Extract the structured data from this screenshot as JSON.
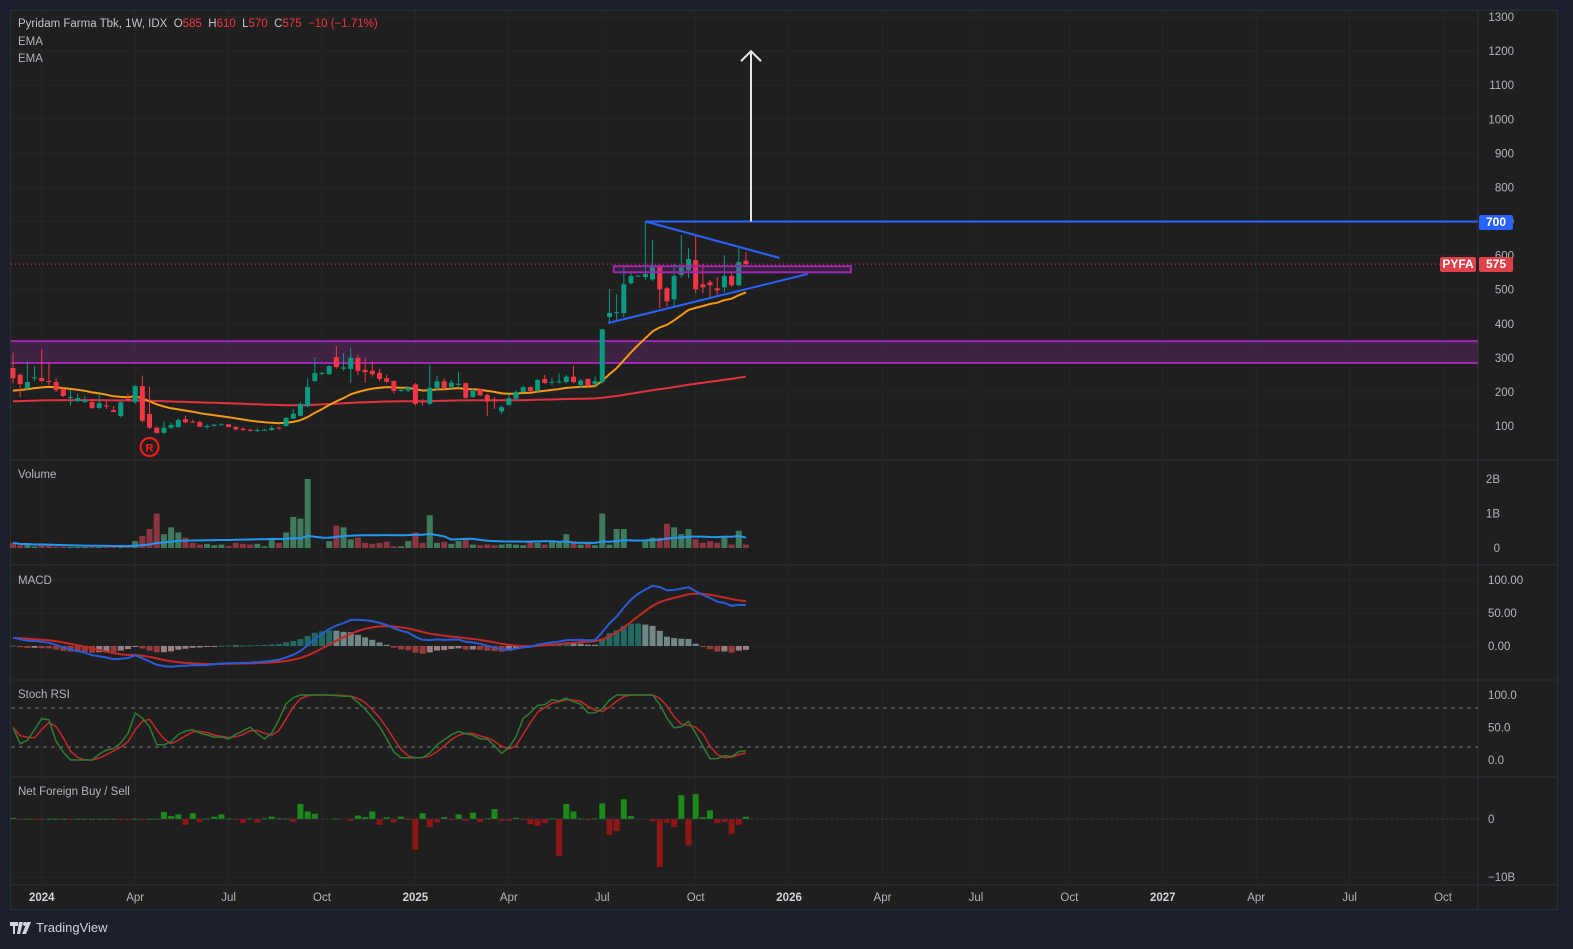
{
  "header": {
    "symbol_line": "Pyridam Farma Tbk, 1W, IDX",
    "o_label": "O",
    "o": "585",
    "h_label": "H",
    "h": "610",
    "l_label": "L",
    "l": "570",
    "c_label": "C",
    "c": "575",
    "change": "−10 (−1.71%)",
    "indicators": [
      "EMA",
      "EMA"
    ]
  },
  "panes": {
    "volume": "Volume",
    "macd": "MACD",
    "stoch": "Stoch RSI",
    "net_foreign": "Net Foreign Buy / Sell"
  },
  "badges": {
    "level": "700",
    "symbol": "PYFA",
    "last": "575"
  },
  "footer": {
    "brand": "TradingView"
  },
  "colors": {
    "up": "#089981",
    "down": "#f23645",
    "ema_fast": "#f59a12",
    "ema_slow": "#e0323f",
    "trendline": "#2962ff",
    "zone": "#9c27b0",
    "volume_up": "#3f7a5c",
    "volume_down": "#8a3540",
    "volume_ma": "#2196f3",
    "macd": "#2a5bd7",
    "signal": "#c62828",
    "stoch_k": "#2e7d32",
    "stoch_d": "#c62828",
    "nf_buy": "#1b8a1b",
    "nf_sell": "#8e1616"
  },
  "chart_data": {
    "type": "candlestick",
    "title": "Pyridam Farma Tbk, 1W, IDX",
    "candles": [
      [
        270,
        315,
        225,
        240
      ],
      [
        250,
        255,
        185,
        223
      ],
      [
        211,
        290,
        205,
        229
      ],
      [
        240,
        276,
        232,
        243
      ],
      [
        241,
        326,
        228,
        232
      ],
      [
        232,
        285,
        220,
        229
      ],
      [
        229,
        240,
        200,
        205
      ],
      [
        208,
        215,
        185,
        188
      ],
      [
        182,
        206,
        160,
        185
      ],
      [
        173,
        195,
        170,
        182
      ],
      [
        170,
        188,
        168,
        176
      ],
      [
        170,
        180,
        150,
        153
      ],
      [
        153,
        195,
        150,
        167
      ],
      [
        160,
        175,
        150,
        157
      ],
      [
        147,
        158,
        140,
        141
      ],
      [
        129,
        172,
        125,
        170
      ],
      [
        180,
        195,
        172,
        176
      ],
      [
        170,
        220,
        165,
        217
      ],
      [
        217,
        248,
        110,
        115
      ],
      [
        135,
        215,
        90,
        95
      ],
      [
        95,
        98,
        78,
        80
      ],
      [
        80,
        115,
        76,
        95
      ],
      [
        95,
        110,
        92,
        103
      ],
      [
        97,
        122,
        95,
        118
      ],
      [
        120,
        130,
        108,
        111
      ],
      [
        113,
        118,
        110,
        112
      ],
      [
        112,
        115,
        97,
        98
      ],
      [
        98,
        105,
        90,
        100
      ],
      [
        101,
        106,
        98,
        104
      ],
      [
        104,
        108,
        102,
        105
      ],
      [
        105,
        106,
        96,
        97
      ],
      [
        97,
        100,
        88,
        90
      ],
      [
        92,
        96,
        86,
        88
      ],
      [
        89,
        92,
        84,
        86
      ],
      [
        86,
        94,
        82,
        88
      ],
      [
        88,
        92,
        86,
        89
      ],
      [
        88,
        100,
        86,
        94
      ],
      [
        95,
        98,
        90,
        94
      ],
      [
        100,
        126,
        98,
        124
      ],
      [
        122,
        150,
        120,
        136
      ],
      [
        130,
        170,
        128,
        165
      ],
      [
        158,
        240,
        155,
        214
      ],
      [
        232,
        302,
        228,
        255
      ],
      [
        254,
        258,
        250,
        256
      ],
      [
        252,
        278,
        250,
        276
      ],
      [
        302,
        335,
        268,
        273
      ],
      [
        268,
        314,
        262,
        272
      ],
      [
        267,
        330,
        226,
        300
      ],
      [
        300,
        310,
        250,
        262
      ],
      [
        265,
        300,
        226,
        258
      ],
      [
        262,
        290,
        245,
        252
      ],
      [
        256,
        268,
        232,
        238
      ],
      [
        240,
        250,
        226,
        230
      ],
      [
        232,
        234,
        195,
        203
      ],
      [
        203,
        212,
        200,
        206
      ],
      [
        204,
        215,
        200,
        213
      ],
      [
        222,
        226,
        160,
        165
      ],
      [
        172,
        180,
        160,
        170
      ],
      [
        165,
        280,
        162,
        212
      ],
      [
        212,
        248,
        205,
        231
      ],
      [
        231,
        240,
        205,
        212
      ],
      [
        215,
        235,
        210,
        227
      ],
      [
        224,
        260,
        210,
        224
      ],
      [
        226,
        228,
        180,
        183
      ],
      [
        185,
        210,
        183,
        203
      ],
      [
        208,
        210,
        188,
        190
      ],
      [
        191,
        195,
        130,
        172
      ],
      [
        176,
        185,
        150,
        172
      ],
      [
        143,
        160,
        135,
        155
      ],
      [
        162,
        190,
        160,
        182
      ],
      [
        180,
        205,
        175,
        200
      ],
      [
        200,
        218,
        198,
        214
      ],
      [
        214,
        216,
        200,
        203
      ],
      [
        203,
        238,
        200,
        235
      ],
      [
        238,
        250,
        224,
        226
      ],
      [
        230,
        240,
        220,
        230
      ],
      [
        228,
        255,
        225,
        231
      ],
      [
        229,
        250,
        225,
        245
      ],
      [
        245,
        276,
        225,
        229
      ],
      [
        220,
        238,
        212,
        233
      ],
      [
        238,
        240,
        215,
        219
      ],
      [
        222,
        245,
        218,
        232
      ],
      [
        229,
        384,
        225,
        384
      ],
      [
        420,
        502,
        402,
        432
      ],
      [
        432,
        487,
        405,
        434
      ],
      [
        431,
        566,
        420,
        516
      ],
      [
        519,
        552,
        515,
        540
      ],
      [
        540,
        542,
        538,
        541
      ],
      [
        537,
        700,
        528,
        546
      ],
      [
        530,
        645,
        525,
        566
      ],
      [
        566,
        570,
        446,
        501
      ],
      [
        504,
        508,
        450,
        466
      ],
      [
        472,
        575,
        446,
        540
      ],
      [
        543,
        660,
        535,
        566
      ],
      [
        557,
        622,
        534,
        590
      ],
      [
        587,
        660,
        490,
        501
      ],
      [
        516,
        575,
        490,
        507
      ],
      [
        522,
        528,
        478,
        513
      ],
      [
        504,
        537,
        478,
        498
      ],
      [
        507,
        601,
        492,
        540
      ],
      [
        540,
        548,
        508,
        513
      ],
      [
        513,
        622,
        510,
        581
      ],
      [
        585,
        610,
        570,
        575
      ]
    ],
    "volume_billions": [
      0.15,
      0.08,
      0.12,
      0.05,
      0.12,
      0.07,
      0.04,
      0.04,
      0.03,
      0.03,
      0.03,
      0.03,
      0.03,
      0.03,
      0.03,
      0.03,
      0.05,
      0.2,
      0.35,
      0.55,
      1.0,
      0.4,
      0.6,
      0.45,
      0.3,
      0.15,
      0.1,
      0.12,
      0.08,
      0.1,
      0.06,
      0.15,
      0.12,
      0.1,
      0.12,
      0.05,
      0.25,
      0.15,
      0.45,
      0.9,
      0.85,
      2.0,
      0,
      0,
      0.2,
      0.65,
      0.6,
      0.25,
      0.3,
      0.15,
      0.12,
      0.15,
      0.18,
      0.05,
      0.05,
      0.2,
      0.45,
      0.15,
      0.95,
      0.15,
      0.18,
      0.12,
      0.2,
      0.25,
      0.1,
      0.08,
      0.1,
      0.08,
      0.1,
      0.12,
      0.1,
      0.08,
      0.2,
      0.15,
      0.1,
      0.2,
      0.15,
      0.4,
      0.2,
      0.1,
      0.15,
      0.08,
      1.0,
      0.1,
      0.55,
      0.55,
      0,
      0,
      0.2,
      0.3,
      0.3,
      0.7,
      0.6,
      0.4,
      0.55,
      0.25,
      0.15,
      0.2,
      0.15,
      0.35,
      0.1,
      0.5,
      0.1
    ],
    "net_foreign_billions": [
      0.2,
      -0.1,
      0.05,
      -0.1,
      -0.1,
      0.05,
      0.05,
      0.05,
      -0.1,
      0.05,
      0.05,
      0.05,
      0.05,
      0.05,
      0.05,
      -0.1,
      -0.2,
      0.05,
      -0.2,
      0.05,
      0.05,
      1.2,
      0.5,
      0.8,
      -1.0,
      1.0,
      -0.5,
      0.1,
      0.4,
      0.8,
      0.1,
      -0.1,
      -0.7,
      0.1,
      -0.6,
      0.1,
      0.4,
      0.1,
      0.1,
      -0.5,
      2.6,
      1.3,
      0.9,
      0,
      0,
      0.1,
      0,
      -0.3,
      0.6,
      0.3,
      1.3,
      -1.0,
      0.3,
      -0.6,
      0.4,
      -0.1,
      -5.3,
      1.0,
      -1.4,
      -0.6,
      0.3,
      -0.1,
      0.8,
      -0.3,
      1.1,
      -0.5,
      0.1,
      1.7,
      -0.3,
      -0.3,
      0.2,
      -0.1,
      -0.9,
      -1.2,
      -0.7,
      0.1,
      -6.4,
      2.6,
      1.3,
      0.1,
      -0.2,
      0.1,
      2.7,
      -2.7,
      -2.1,
      3.4,
      0.5,
      0,
      0,
      -0.4,
      -8.3,
      -0.7,
      -1.4,
      4.1,
      -4.6,
      4.3,
      0.3,
      1.5,
      -0.7,
      -0.5,
      -2.6,
      -1.0,
      0.4
    ],
    "ema_fast": {
      "period": 20,
      "seed": 200
    },
    "ema_slow": {
      "period": 200,
      "seed": 172
    },
    "volume_ma_period": 20,
    "macd_params": {
      "fast": 12,
      "slow": 26,
      "signal": 9,
      "seed_fast": 250,
      "seed_slow": 235,
      "seed_signal": 12
    },
    "stoch_rsi_params": {
      "rsi": 14,
      "stoch": 14,
      "k": 3,
      "d": 3,
      "upper_band": 80,
      "lower_band": 20
    },
    "price_axis": {
      "ticks": [
        100,
        200,
        300,
        400,
        500,
        600,
        700,
        800,
        900,
        1000,
        1100,
        1200,
        1300
      ],
      "range": [
        0,
        1300
      ]
    },
    "volume_axis": {
      "ticks": [
        {
          "v": 0,
          "label": "0"
        },
        {
          "v": 1,
          "label": "1B"
        },
        {
          "v": 2,
          "label": "2B"
        }
      ]
    },
    "macd_axis": {
      "ticks": [
        {
          "v": 0,
          "label": "0.00"
        },
        {
          "v": 50,
          "label": "50.00"
        },
        {
          "v": 100,
          "label": "100.00"
        }
      ]
    },
    "stoch_axis": {
      "ticks": [
        {
          "v": 0,
          "label": "0.0"
        },
        {
          "v": 50,
          "label": "50.0"
        },
        {
          "v": 100,
          "label": "100.0"
        }
      ]
    },
    "nf_axis": {
      "ticks": [
        {
          "v": 0,
          "label": "0"
        },
        {
          "v": -10,
          "label": "−10B"
        }
      ]
    },
    "time_labels": [
      {
        "label": "2024",
        "year": true
      },
      {
        "label": "Apr"
      },
      {
        "label": "Jul"
      },
      {
        "label": "Oct"
      },
      {
        "label": "2025",
        "year": true
      },
      {
        "label": "Apr"
      },
      {
        "label": "Jul"
      },
      {
        "label": "Oct"
      },
      {
        "label": "2026",
        "year": true
      },
      {
        "label": "Apr"
      },
      {
        "label": "Jul"
      },
      {
        "label": "Oct"
      },
      {
        "label": "2027",
        "year": true
      },
      {
        "label": "Apr"
      },
      {
        "label": "Jul"
      },
      {
        "label": "Oct"
      }
    ],
    "time_first_label_index": 4,
    "weeks_per_label": 13,
    "last_price": 575,
    "drawings": {
      "resistance_level": {
        "price": 700,
        "from_index": 88
      },
      "triangle_upper": {
        "from": [
          88,
          700
        ],
        "to": [
          106.7,
          593
        ]
      },
      "triangle_lower": {
        "from": [
          82.8,
          402
        ],
        "to": [
          110.6,
          546
        ]
      },
      "breakout_box": {
        "from_index": 83.6,
        "to_index": 116.6,
        "low": 551,
        "high": 569
      },
      "support_zone": {
        "low": 285,
        "high": 349
      },
      "target_arrow": {
        "index": 102.7,
        "from": 700,
        "to": 1200
      },
      "marker": {
        "index": 19,
        "label": "R"
      }
    }
  }
}
